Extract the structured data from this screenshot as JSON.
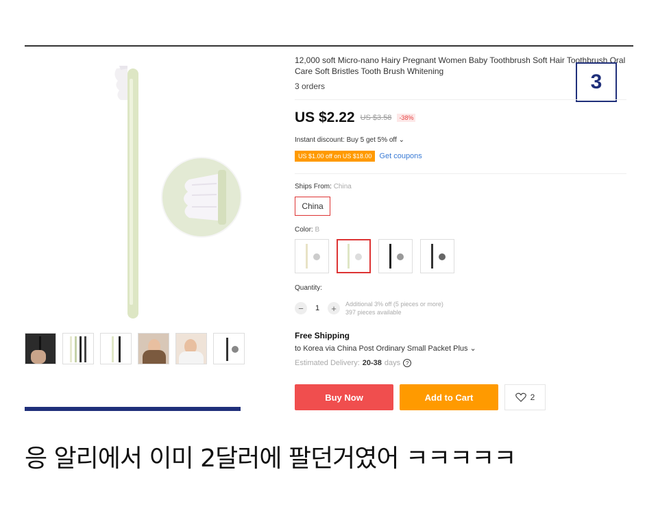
{
  "product": {
    "title": "12,000 soft Micro-nano Hairy Pregnant Women Baby Toothbrush Soft Hair Toothbrush Oral Care Soft Bristles Tooth Brush Whitening",
    "orders": "3 orders",
    "price": "US $2.22",
    "original_price": "US $3.58",
    "discount": "-38%",
    "instant_discount": "Instant discount: Buy 5 get 5% off ⌄",
    "coupon_tag": "US $1.00 off on US $18.00",
    "coupon_link": "Get coupons",
    "ships_from_label": "Ships From:",
    "ships_from_value": "China",
    "ships_from_option": "China",
    "color_label": "Color:",
    "color_value": "B",
    "quantity_label": "Quantity:",
    "quantity_value": "1",
    "quantity_note": "Additional 3% off (5 pieces or more)",
    "available": "397 pieces available",
    "free_shipping": "Free Shipping",
    "ship_via": "to Korea via China Post Ordinary Small Packet Plus ⌄",
    "delivery_label": "Estimated Delivery:",
    "delivery_value": "20-38",
    "delivery_unit": "days",
    "buy_now": "Buy Now",
    "add_to_cart": "Add to Cart",
    "wish_count": "2"
  },
  "badge": "3",
  "caption": "응 알리에서 이미 2달러에 팔던거였어 ㅋㅋㅋㅋㅋ",
  "icons": [
    "toothbrush-image",
    "help-icon",
    "heart-icon",
    "minus-icon",
    "plus-icon"
  ],
  "colors": {
    "buy_now": "#f04e4e",
    "add_to_cart": "#ff9a00",
    "badge": "#1f2f7a",
    "selected_border": "#d33333"
  }
}
